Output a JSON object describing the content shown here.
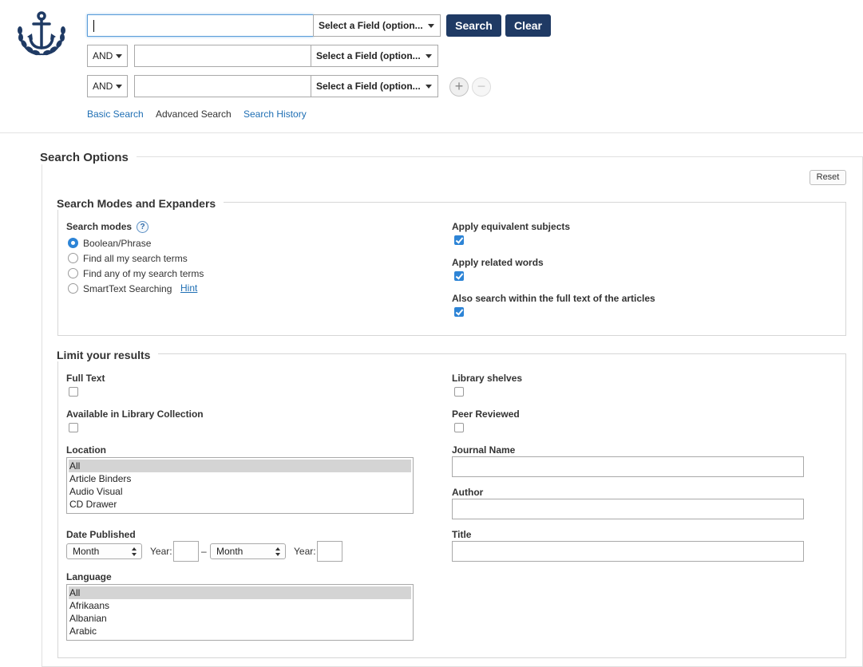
{
  "search": {
    "rows": [
      {
        "field_label": "Select a Field (option..."
      },
      {
        "operator": "AND",
        "field_label": "Select a Field (option..."
      },
      {
        "operator": "AND",
        "field_label": "Select a Field (option..."
      }
    ],
    "search_label": "Search",
    "clear_label": "Clear",
    "add_symbol": "+",
    "remove_symbol": "−",
    "tabs": [
      "Basic Search",
      "Advanced Search",
      "Search History"
    ]
  },
  "options": {
    "title": "Search Options",
    "reset_label": "Reset",
    "modes_section": {
      "title": "Search Modes and Expanders",
      "modes_label": "Search modes",
      "help_symbol": "?",
      "modes": [
        "Boolean/Phrase",
        "Find all my search terms",
        "Find any of my search terms",
        "SmartText Searching"
      ],
      "selected_mode": "Boolean/Phrase",
      "hint_label": "Hint",
      "expanders": [
        {
          "label": "Apply equivalent subjects",
          "checked": true
        },
        {
          "label": "Apply related words",
          "checked": true
        },
        {
          "label": "Also search within the full text of the articles",
          "checked": true
        }
      ]
    },
    "limits": {
      "title": "Limit your results",
      "full_text": "Full Text",
      "available": "Available in Library Collection",
      "location_label": "Location",
      "locations": [
        "All",
        "Article Binders",
        "Audio Visual",
        "CD Drawer"
      ],
      "date_label": "Date Published",
      "month_label": "Month",
      "year_label": "Year:",
      "dash": "–",
      "language_label": "Language",
      "languages": [
        "All",
        "Afrikaans",
        "Albanian",
        "Arabic"
      ],
      "library_shelves": "Library shelves",
      "peer_reviewed": "Peer Reviewed",
      "journal_name": "Journal Name",
      "author": "Author",
      "title_field": "Title"
    }
  },
  "colors": {
    "primary_button": "#1f3a64",
    "link": "#1f6fb4",
    "checkbox": "#2d84d6"
  }
}
